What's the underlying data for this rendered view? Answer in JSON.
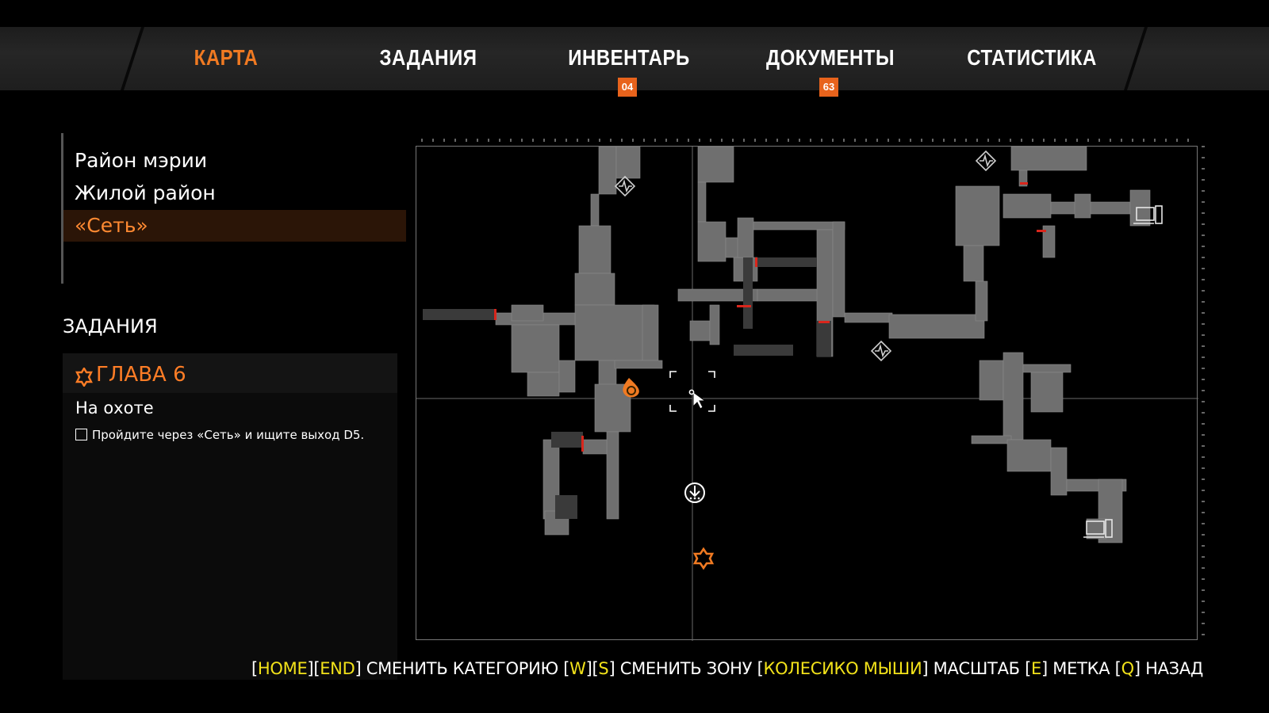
{
  "nav": {
    "tabs": [
      {
        "label": "КАРТА",
        "active": true
      },
      {
        "label": "ЗАДАНИЯ"
      },
      {
        "label": "ИНВЕНТАРЬ",
        "badge": "04"
      },
      {
        "label": "ДОКУМЕНТЫ",
        "badge": "63"
      },
      {
        "label": "СТАТИСТИКА"
      }
    ]
  },
  "zones": [
    {
      "label": "Район мэрии"
    },
    {
      "label": "Жилой район"
    },
    {
      "label": "«Сеть»",
      "selected": true
    }
  ],
  "tasks": {
    "title": "ЗАДАНИЯ",
    "chapter": "ГЛАВА  6",
    "mission": "На охоте",
    "objective": "Пройдите через «Сеть» и ищите выход D5."
  },
  "map": {
    "icons": [
      "player-marker-icon",
      "cursor-icon",
      "save-point-icon",
      "objective-star-icon",
      "wanderer-icon",
      "computer-terminal-icon"
    ],
    "accent_color": "#f07a22",
    "door_color": "#d9261c"
  },
  "hints": {
    "k1": "HOME",
    "k2": "END",
    "t1": "СМЕНИТЬ КАТЕГОРИЮ",
    "k3": "W",
    "k4": "S",
    "t2": "СМЕНИТЬ ЗОНУ",
    "k5": "КОЛЕСИКО МЫШИ",
    "t3": "МАСШТАБ",
    "k6": "E",
    "t4": "МЕТКА",
    "k7": "Q",
    "t5": "НАЗАД"
  },
  "colors": {
    "accent": "#f07a22",
    "badge": "#e8631c",
    "selected_bg": "#2b1507",
    "hint_key": "#f2e21a"
  }
}
